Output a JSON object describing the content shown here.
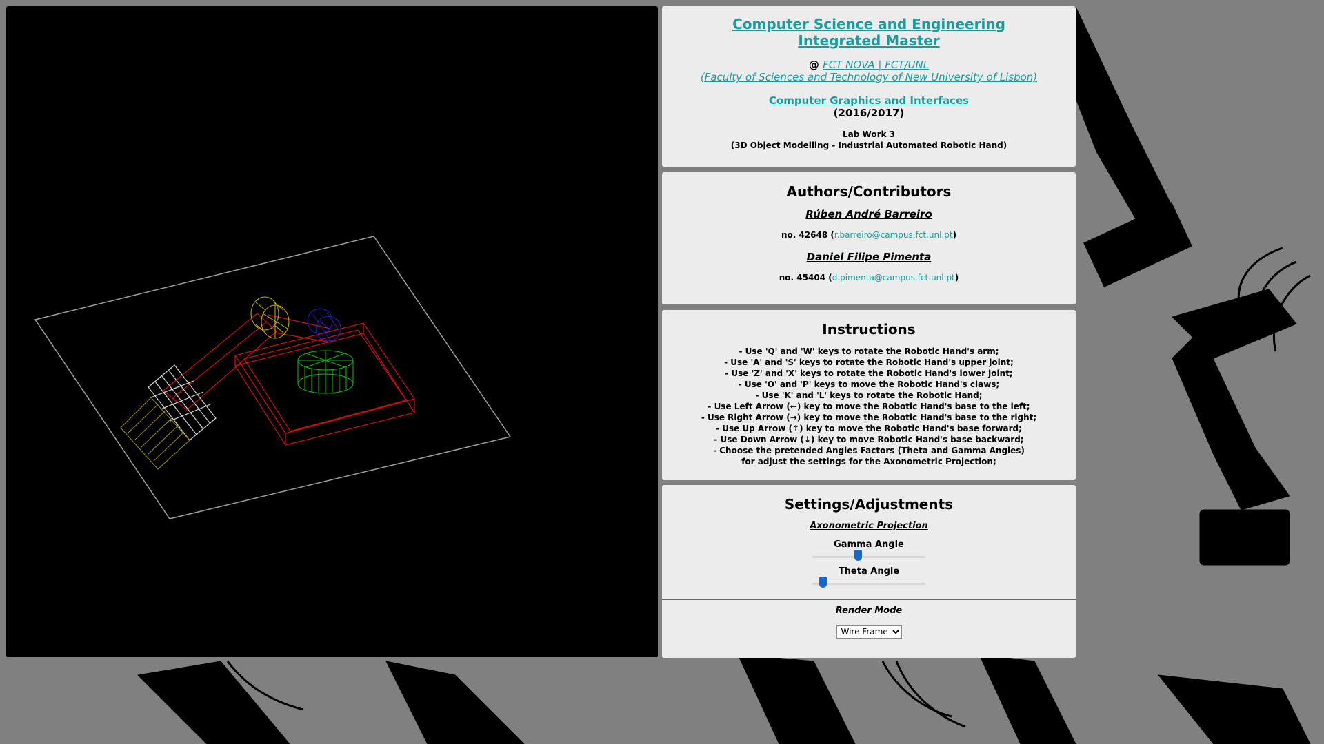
{
  "header": {
    "title_line1": "Computer Science and Engineering",
    "title_line2": "Integrated Master",
    "at": "@ ",
    "fct_link": "FCT NOVA | FCT/UNL",
    "faculty": "(Faculty of Sciences and Technology of New University of Lisbon)",
    "course": "Computer Graphics and Interfaces",
    "year": "(2016/2017)",
    "lab_line1": "Lab Work 3",
    "lab_line2": "(3D Object Modelling - Industrial Automated Robotic Hand)"
  },
  "authors": {
    "heading": "Authors/Contributors",
    "list": [
      {
        "name": "Rúben André Barreiro",
        "number_prefix": "no. 42648 (",
        "email": "r.barreiro@campus.fct.unl.pt",
        "number_suffix": ")"
      },
      {
        "name": "Daniel Filipe Pimenta",
        "number_prefix": "no. 45404 (",
        "email": "d.pimenta@campus.fct.unl.pt",
        "number_suffix": ")"
      }
    ]
  },
  "instructions": {
    "heading": "Instructions",
    "lines": [
      "- Use 'Q' and 'W' keys to rotate the Robotic Hand's arm;",
      "- Use 'A' and 'S' keys to rotate the Robotic Hand's upper joint;",
      "- Use 'Z' and 'X' keys to rotate the Robotic Hand's lower joint;",
      "- Use 'O' and 'P' keys to move the Robotic Hand's claws;",
      "- Use 'K' and 'L' keys to rotate the Robotic Hand;",
      "- Use Left Arrow (←) key to move the Robotic Hand's base to the left;",
      "- Use Right Arrow (→) key to move the Robotic Hand's base to the right;",
      "- Use Up Arrow (↑) key to move the Robotic Hand's base forward;",
      "- Use Down Arrow (↓) key to move Robotic Hand's base backward;",
      "- Choose the pretended Angles Factors (Theta and Gamma Angles)",
      "for adjust the settings for the Axonometric Projection;"
    ]
  },
  "settings": {
    "heading": "Settings/Adjustments",
    "projection_label": "Axonometric Projection",
    "gamma_label": "Gamma Angle",
    "gamma_value_fraction": 0.4,
    "theta_label": "Theta Angle",
    "theta_value_fraction": 0.09,
    "render_label": "Render Mode",
    "render_selected": "Wire Frame"
  },
  "colors": {
    "link": "#1a9c9c",
    "panel_bg": "#ececec",
    "page_bg": "#808080",
    "slider_thumb": "#1667c8",
    "wire_red": "#d01010",
    "wire_yellow": "#c8b400",
    "wire_green": "#10c010",
    "wire_blue": "#2020d0",
    "wire_white": "#e0e0e0",
    "floor": "#a0a0a0"
  },
  "icons": {
    "background": "robot-arm-silhouette-icon",
    "select_arrow": "chevron-down-icon"
  }
}
